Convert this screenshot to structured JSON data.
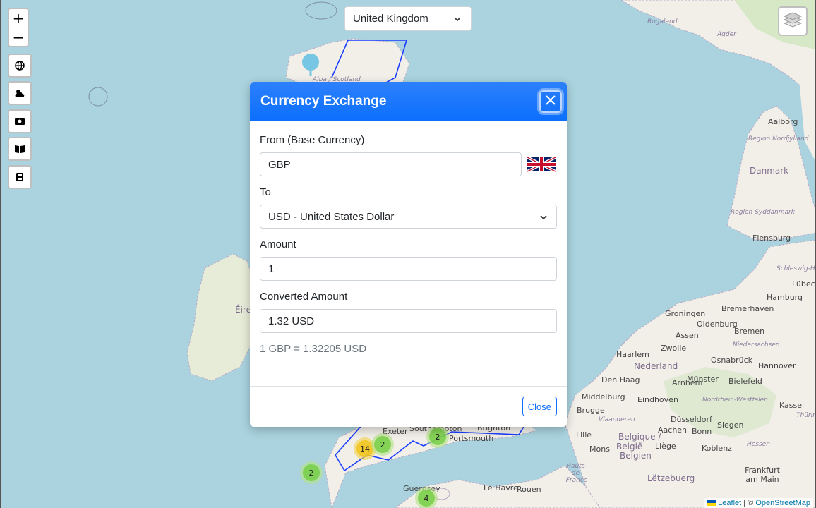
{
  "country_select": {
    "value": "United Kingdom"
  },
  "map_controls": {
    "zoom_in": "+",
    "zoom_out": "−",
    "tools": [
      "globe-icon",
      "weather-icon",
      "money-icon",
      "book-icon",
      "calculator-icon"
    ]
  },
  "map_labels": {
    "rogaland": "Rogaland",
    "agder": "Agder",
    "aalborg": "Aalborg",
    "region_nordjylland": "Region Nordjylland",
    "danmark": "Danmark",
    "region_syddanmark": "Region Syddanmark",
    "flensburg": "Flensburg",
    "schleswig_holstein": "Schleswig-Holstein",
    "lubeck": "Lübeck",
    "hamburg": "Hamburg",
    "groningen": "Groningen",
    "bremerhaven": "Bremerhaven",
    "oldenburg": "Oldenburg",
    "assen": "Assen",
    "bremen": "Bremen",
    "niedersachsen": "Niedersachsen",
    "zwolle": "Zwolle",
    "haarlem": "Haarlem",
    "osnabruck": "Osnabrück",
    "hannover": "Hannover",
    "nederland": "Nederland",
    "den_haag": "Den Haag",
    "arnhem": "Arnhem",
    "munster": "Münster",
    "bielefeld": "Bielefeld",
    "middelburg": "Middelburg",
    "eindhoven": "Eindhoven",
    "nordrhein_westfalen": "Nordrhein-Westfalen",
    "kassel": "Kassel",
    "brugge": "Brugge",
    "vlaanderen": "Vlaanderen",
    "dusseldorf": "Düsseldorf",
    "siegen": "Siegen",
    "lille": "Lille",
    "aachen": "Aachen",
    "bonn": "Bonn",
    "thuringen": "Thürin",
    "mons": "Mons",
    "belgique": "Belgique /",
    "belgie": "België",
    "liege": "Liège",
    "koblenz": "Koblenz",
    "hessen": "Hessen",
    "belgien": "Belgien",
    "hauts_de_france": "Hauts-de-France",
    "frankfurt": "Frankfurt am Main",
    "letzebuerg": "Lëtzebuerg",
    "guernsey": "Guernsey",
    "le_havre": "Le Havre",
    "rouen": "Rouen",
    "alba_scotland": "Alba / Scotland",
    "eire": "Éire",
    "exeter": "Exeter",
    "southampton": "Southampton",
    "portsmouth": "Portsmouth",
    "brighton": "Brighton"
  },
  "clusters": [
    {
      "label": "2",
      "color": "green"
    },
    {
      "label": "14",
      "color": "yellow"
    },
    {
      "label": "2",
      "color": "green"
    },
    {
      "label": "2",
      "color": "green"
    },
    {
      "label": "4",
      "color": "green"
    }
  ],
  "attribution": {
    "leaflet": "Leaflet",
    "separator": " | © ",
    "osm": "OpenStreetMap"
  },
  "modal": {
    "title": "Currency Exchange",
    "from_label": "From (Base Currency)",
    "from_value": "GBP",
    "from_flag": "united-kingdom-flag",
    "to_label": "To",
    "to_value": "USD - United States Dollar",
    "amount_label": "Amount",
    "amount_value": "1",
    "converted_label": "Converted Amount",
    "converted_value": "1.32 USD",
    "rate_text": "1 GBP = 1.32205 USD",
    "close_button": "Close"
  },
  "colors": {
    "sea": "#aad3df",
    "land": "#f2efe9",
    "modal_header": "#0d6efd",
    "selection_outline": "#1a3dff"
  }
}
